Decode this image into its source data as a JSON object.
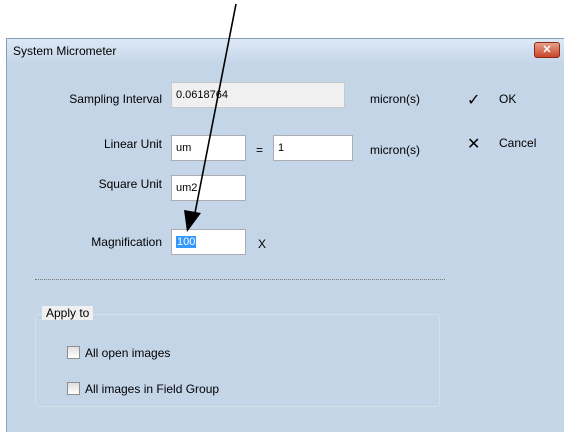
{
  "window": {
    "title": "System Micrometer",
    "close_glyph": "✕"
  },
  "form": {
    "sampling_interval": {
      "label": "Sampling Interval",
      "value": "0.0618764",
      "unit": "micron(s)"
    },
    "linear_unit": {
      "label": "Linear Unit",
      "value": "um",
      "equals": "=",
      "factor": "1",
      "unit": "micron(s)"
    },
    "square_unit": {
      "label": "Square Unit",
      "value": "um2"
    },
    "magnification": {
      "label": "Magnification",
      "value": "100",
      "unit": "X"
    }
  },
  "buttons": {
    "ok": {
      "label": "OK",
      "icon": "checkmark-icon",
      "glyph": "✓"
    },
    "cancel": {
      "label": "Cancel",
      "icon": "cross-icon",
      "glyph": "✕"
    }
  },
  "apply_to": {
    "title": "Apply to",
    "options": [
      {
        "label": "All open images",
        "checked": false
      },
      {
        "label": "All images in Field Group",
        "checked": false
      }
    ]
  },
  "colors": {
    "selection": "#3399ff",
    "dialog_background": "#f0f0f0",
    "frame": "#c4d5e8",
    "annotation_arrow": "#000000"
  }
}
